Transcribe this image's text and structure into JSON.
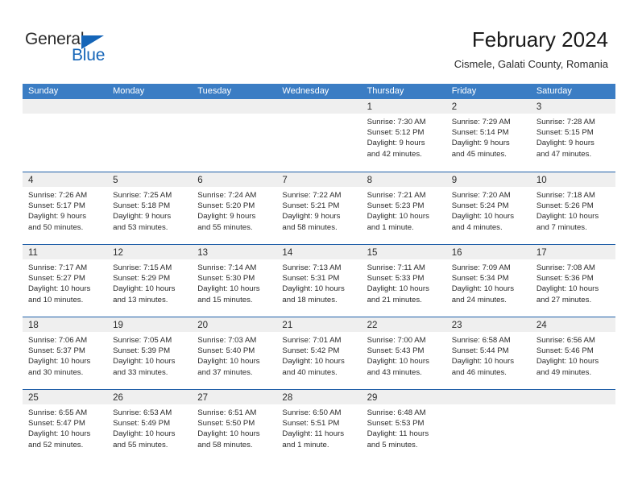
{
  "brand": {
    "name_part1": "General",
    "name_part2": "Blue",
    "triangle_icon": "triangle-icon",
    "accent_color": "#1565b8"
  },
  "header": {
    "title": "February 2024",
    "subtitle": "Cismele, Galati County, Romania"
  },
  "theme": {
    "weekday_header_bg": "#3b7dc4",
    "row_divider": "#1f5fa8",
    "day_number_strip_bg": "#efefef",
    "text": "#2b2b2b"
  },
  "weekdays": [
    "Sunday",
    "Monday",
    "Tuesday",
    "Wednesday",
    "Thursday",
    "Friday",
    "Saturday"
  ],
  "weeks": [
    [
      {
        "day": "",
        "empty": true
      },
      {
        "day": "",
        "empty": true
      },
      {
        "day": "",
        "empty": true
      },
      {
        "day": "",
        "empty": true
      },
      {
        "day": "1",
        "sunrise": "Sunrise: 7:30 AM",
        "sunset": "Sunset: 5:12 PM",
        "daylight_1": "Daylight: 9 hours",
        "daylight_2": "and 42 minutes."
      },
      {
        "day": "2",
        "sunrise": "Sunrise: 7:29 AM",
        "sunset": "Sunset: 5:14 PM",
        "daylight_1": "Daylight: 9 hours",
        "daylight_2": "and 45 minutes."
      },
      {
        "day": "3",
        "sunrise": "Sunrise: 7:28 AM",
        "sunset": "Sunset: 5:15 PM",
        "daylight_1": "Daylight: 9 hours",
        "daylight_2": "and 47 minutes."
      }
    ],
    [
      {
        "day": "4",
        "sunrise": "Sunrise: 7:26 AM",
        "sunset": "Sunset: 5:17 PM",
        "daylight_1": "Daylight: 9 hours",
        "daylight_2": "and 50 minutes."
      },
      {
        "day": "5",
        "sunrise": "Sunrise: 7:25 AM",
        "sunset": "Sunset: 5:18 PM",
        "daylight_1": "Daylight: 9 hours",
        "daylight_2": "and 53 minutes."
      },
      {
        "day": "6",
        "sunrise": "Sunrise: 7:24 AM",
        "sunset": "Sunset: 5:20 PM",
        "daylight_1": "Daylight: 9 hours",
        "daylight_2": "and 55 minutes."
      },
      {
        "day": "7",
        "sunrise": "Sunrise: 7:22 AM",
        "sunset": "Sunset: 5:21 PM",
        "daylight_1": "Daylight: 9 hours",
        "daylight_2": "and 58 minutes."
      },
      {
        "day": "8",
        "sunrise": "Sunrise: 7:21 AM",
        "sunset": "Sunset: 5:23 PM",
        "daylight_1": "Daylight: 10 hours",
        "daylight_2": "and 1 minute."
      },
      {
        "day": "9",
        "sunrise": "Sunrise: 7:20 AM",
        "sunset": "Sunset: 5:24 PM",
        "daylight_1": "Daylight: 10 hours",
        "daylight_2": "and 4 minutes."
      },
      {
        "day": "10",
        "sunrise": "Sunrise: 7:18 AM",
        "sunset": "Sunset: 5:26 PM",
        "daylight_1": "Daylight: 10 hours",
        "daylight_2": "and 7 minutes."
      }
    ],
    [
      {
        "day": "11",
        "sunrise": "Sunrise: 7:17 AM",
        "sunset": "Sunset: 5:27 PM",
        "daylight_1": "Daylight: 10 hours",
        "daylight_2": "and 10 minutes."
      },
      {
        "day": "12",
        "sunrise": "Sunrise: 7:15 AM",
        "sunset": "Sunset: 5:29 PM",
        "daylight_1": "Daylight: 10 hours",
        "daylight_2": "and 13 minutes."
      },
      {
        "day": "13",
        "sunrise": "Sunrise: 7:14 AM",
        "sunset": "Sunset: 5:30 PM",
        "daylight_1": "Daylight: 10 hours",
        "daylight_2": "and 15 minutes."
      },
      {
        "day": "14",
        "sunrise": "Sunrise: 7:13 AM",
        "sunset": "Sunset: 5:31 PM",
        "daylight_1": "Daylight: 10 hours",
        "daylight_2": "and 18 minutes."
      },
      {
        "day": "15",
        "sunrise": "Sunrise: 7:11 AM",
        "sunset": "Sunset: 5:33 PM",
        "daylight_1": "Daylight: 10 hours",
        "daylight_2": "and 21 minutes."
      },
      {
        "day": "16",
        "sunrise": "Sunrise: 7:09 AM",
        "sunset": "Sunset: 5:34 PM",
        "daylight_1": "Daylight: 10 hours",
        "daylight_2": "and 24 minutes."
      },
      {
        "day": "17",
        "sunrise": "Sunrise: 7:08 AM",
        "sunset": "Sunset: 5:36 PM",
        "daylight_1": "Daylight: 10 hours",
        "daylight_2": "and 27 minutes."
      }
    ],
    [
      {
        "day": "18",
        "sunrise": "Sunrise: 7:06 AM",
        "sunset": "Sunset: 5:37 PM",
        "daylight_1": "Daylight: 10 hours",
        "daylight_2": "and 30 minutes."
      },
      {
        "day": "19",
        "sunrise": "Sunrise: 7:05 AM",
        "sunset": "Sunset: 5:39 PM",
        "daylight_1": "Daylight: 10 hours",
        "daylight_2": "and 33 minutes."
      },
      {
        "day": "20",
        "sunrise": "Sunrise: 7:03 AM",
        "sunset": "Sunset: 5:40 PM",
        "daylight_1": "Daylight: 10 hours",
        "daylight_2": "and 37 minutes."
      },
      {
        "day": "21",
        "sunrise": "Sunrise: 7:01 AM",
        "sunset": "Sunset: 5:42 PM",
        "daylight_1": "Daylight: 10 hours",
        "daylight_2": "and 40 minutes."
      },
      {
        "day": "22",
        "sunrise": "Sunrise: 7:00 AM",
        "sunset": "Sunset: 5:43 PM",
        "daylight_1": "Daylight: 10 hours",
        "daylight_2": "and 43 minutes."
      },
      {
        "day": "23",
        "sunrise": "Sunrise: 6:58 AM",
        "sunset": "Sunset: 5:44 PM",
        "daylight_1": "Daylight: 10 hours",
        "daylight_2": "and 46 minutes."
      },
      {
        "day": "24",
        "sunrise": "Sunrise: 6:56 AM",
        "sunset": "Sunset: 5:46 PM",
        "daylight_1": "Daylight: 10 hours",
        "daylight_2": "and 49 minutes."
      }
    ],
    [
      {
        "day": "25",
        "sunrise": "Sunrise: 6:55 AM",
        "sunset": "Sunset: 5:47 PM",
        "daylight_1": "Daylight: 10 hours",
        "daylight_2": "and 52 minutes."
      },
      {
        "day": "26",
        "sunrise": "Sunrise: 6:53 AM",
        "sunset": "Sunset: 5:49 PM",
        "daylight_1": "Daylight: 10 hours",
        "daylight_2": "and 55 minutes."
      },
      {
        "day": "27",
        "sunrise": "Sunrise: 6:51 AM",
        "sunset": "Sunset: 5:50 PM",
        "daylight_1": "Daylight: 10 hours",
        "daylight_2": "and 58 minutes."
      },
      {
        "day": "28",
        "sunrise": "Sunrise: 6:50 AM",
        "sunset": "Sunset: 5:51 PM",
        "daylight_1": "Daylight: 11 hours",
        "daylight_2": "and 1 minute."
      },
      {
        "day": "29",
        "sunrise": "Sunrise: 6:48 AM",
        "sunset": "Sunset: 5:53 PM",
        "daylight_1": "Daylight: 11 hours",
        "daylight_2": "and 5 minutes."
      },
      {
        "day": "",
        "empty": true
      },
      {
        "day": "",
        "empty": true
      }
    ]
  ]
}
